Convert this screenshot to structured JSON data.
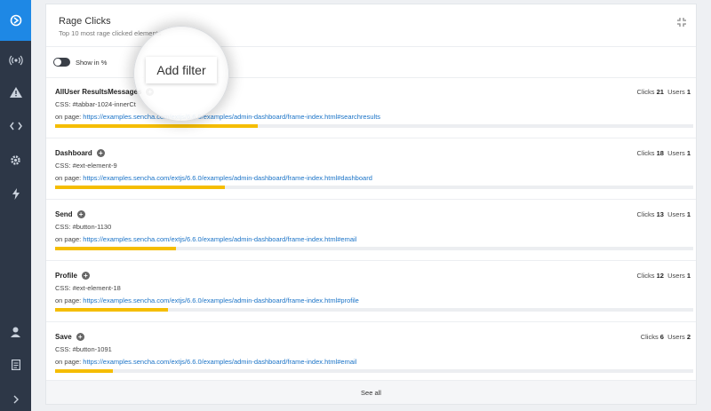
{
  "sidebar": {
    "items": [
      {
        "icon": "logo-icon"
      },
      {
        "icon": "broadcast-icon"
      },
      {
        "icon": "warning-icon"
      },
      {
        "icon": "code-icon"
      },
      {
        "icon": "gear-icon"
      },
      {
        "icon": "lightning-icon"
      },
      {
        "icon": "user-icon"
      },
      {
        "icon": "report-icon"
      },
      {
        "icon": "chevron-right-icon"
      }
    ]
  },
  "panel": {
    "title": "Rage Clicks",
    "subtitle": "Top 10 most rage clicked elements",
    "toggle_label": "Show in %",
    "tooltip": "Add filter",
    "see_all": "See all",
    "rows": [
      {
        "name": "AllUser ResultsMessages",
        "css": "CSS: #tabbar-1024-innerCt",
        "page_prefix": "on page: ",
        "url": "https://examples.sencha.com/extjs/6.6.0/examples/admin-dashboard/frame-index.html#searchresults",
        "clicks_label": "Clicks",
        "clicks": "21",
        "users_label": "Users",
        "users": "1",
        "bar_fraction": 0.317
      },
      {
        "name": "Dashboard",
        "css": "CSS: #ext-element-9",
        "page_prefix": "on page: ",
        "url": "https://examples.sencha.com/extjs/6.6.0/examples/admin-dashboard/frame-index.html#dashboard",
        "clicks_label": "Clicks",
        "clicks": "18",
        "users_label": "Users",
        "users": "1",
        "bar_fraction": 0.266
      },
      {
        "name": "Send",
        "css": "CSS: #button-1130",
        "page_prefix": "on page: ",
        "url": "https://examples.sencha.com/extjs/6.6.0/examples/admin-dashboard/frame-index.html#email",
        "clicks_label": "Clicks",
        "clicks": "13",
        "users_label": "Users",
        "users": "1",
        "bar_fraction": 0.19
      },
      {
        "name": "Profile",
        "css": "CSS: #ext-element-18",
        "page_prefix": "on page: ",
        "url": "https://examples.sencha.com/extjs/6.6.0/examples/admin-dashboard/frame-index.html#profile",
        "clicks_label": "Clicks",
        "clicks": "12",
        "users_label": "Users",
        "users": "1",
        "bar_fraction": 0.177
      },
      {
        "name": "Save",
        "css": "CSS: #button-1091",
        "page_prefix": "on page: ",
        "url": "https://examples.sencha.com/extjs/6.6.0/examples/admin-dashboard/frame-index.html#email",
        "clicks_label": "Clicks",
        "clicks": "6",
        "users_label": "Users",
        "users": "2",
        "bar_fraction": 0.09
      }
    ]
  },
  "colors": {
    "sidebar_bg": "#2d3747",
    "active": "#1e88e5",
    "bar": "#f5bd00",
    "link": "#1a73c7"
  }
}
